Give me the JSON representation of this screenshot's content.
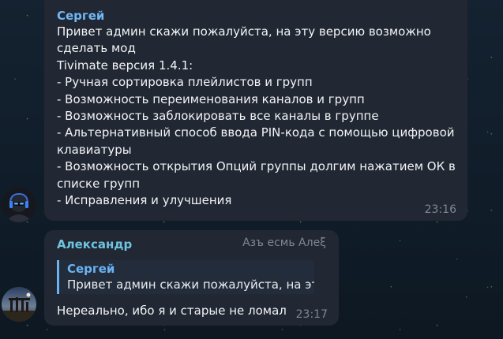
{
  "messages": [
    {
      "author": "Сергей",
      "lines": [
        "Привет админ скажи пожалуйста, на эту версию возможно",
        "сделать мод",
        "Tivimate версия 1.4.1:",
        "- Ручная сортировка плейлистов и групп",
        "- Возможность переименования каналов и групп",
        "- Возможность заблокировать все каналы в группе",
        "- Альтернативный способ ввода PIN-кода с помощью цифровой",
        "клавиатуры",
        "- Возможность открытия Опций группы долгим нажатием ОК в",
        "списке групп",
        "- Исправления и улучшения"
      ],
      "time": "23:16"
    },
    {
      "author": "Александр",
      "badge": "Азъ есмь Алеξ",
      "reply": {
        "author": "Сергей",
        "text": "Привет админ скажи пожалуйста, на эту ..."
      },
      "text": "Нереально, ибо я и старые не ломал",
      "time": "23:17"
    }
  ],
  "colors": {
    "bubble": "#212733",
    "author1": "#71b7f5",
    "author2": "#6ec4e1",
    "reply_accent": "#6ab3f3",
    "meta": "#7d8893"
  }
}
